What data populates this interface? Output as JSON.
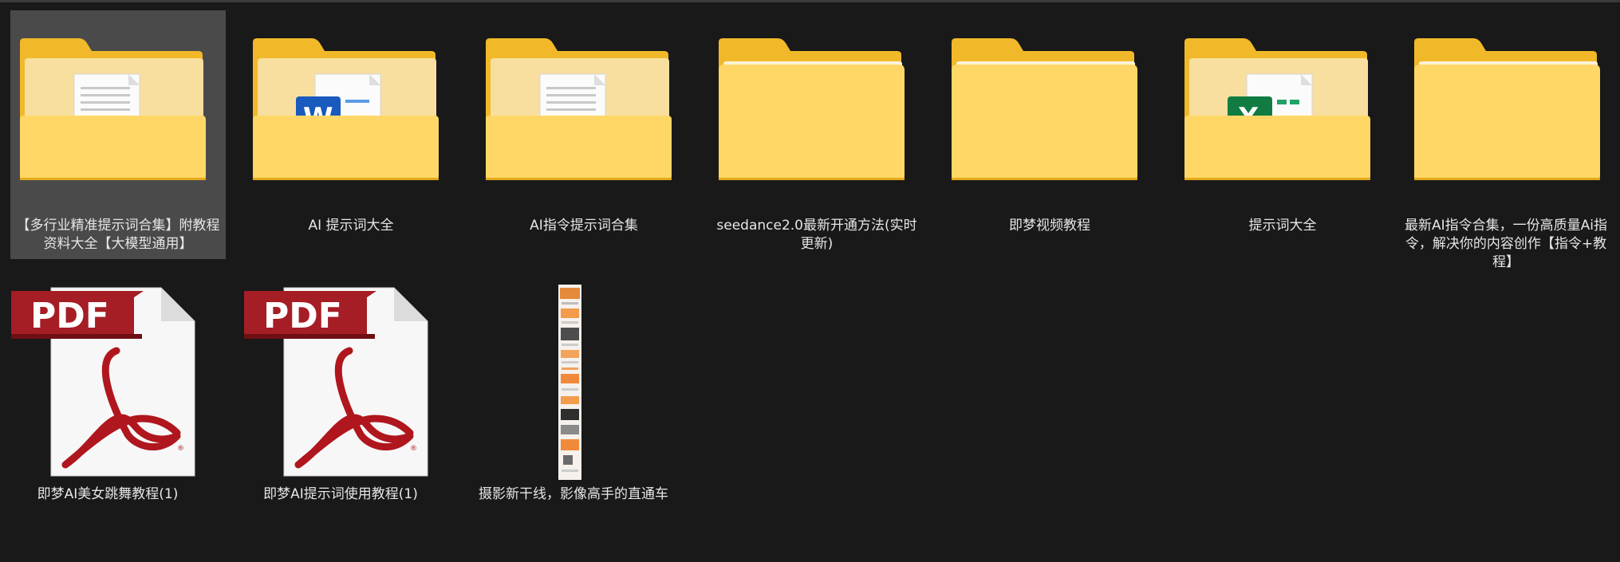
{
  "items": [
    {
      "label": "【多行业精准提示词合集】附教程资料大全【大模型通用】",
      "type": "folder",
      "content": "doc",
      "selected": true
    },
    {
      "label": "AI 提示词大全",
      "type": "folder",
      "content": "word"
    },
    {
      "label": "AI指令提示词合集",
      "type": "folder",
      "content": "doc"
    },
    {
      "label": "seedance2.0最新开通方法(实时更新)",
      "type": "folder",
      "content": "empty"
    },
    {
      "label": "即梦视频教程",
      "type": "folder",
      "content": "empty"
    },
    {
      "label": "提示词大全",
      "type": "folder",
      "content": "excel"
    },
    {
      "label": "最新AI指令合集，一份高质量Ai指令，解决你的内容创作【指令+教程】",
      "type": "folder",
      "content": "empty"
    },
    {
      "label": "即梦AI美女跳舞教程(1)",
      "type": "pdf",
      "badge": "PDF"
    },
    {
      "label": "即梦AI提示词使用教程(1)",
      "type": "pdf",
      "badge": "PDF"
    },
    {
      "label": "摄影新干线，影像高手的直通车",
      "type": "image"
    }
  ],
  "colors": {
    "background": "#191919",
    "selected": "#4a4a4a",
    "folder_back": "#f1b92a",
    "folder_front": "#ffd766",
    "pdf_badge": "#a51d25",
    "word_blue": "#185abd",
    "excel_green": "#107c41"
  }
}
